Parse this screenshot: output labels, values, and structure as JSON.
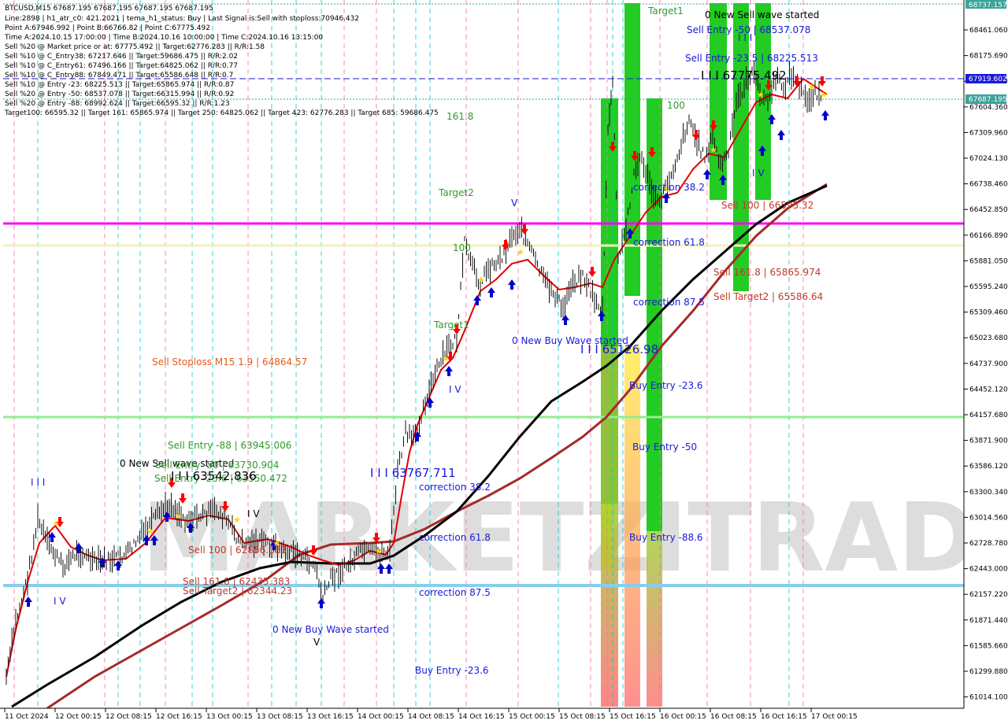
{
  "symbol_line": "BTCUSD,M15  67687.195 67687.195 67687.195 67687.195",
  "info_lines": [
    "Line:2898 | h1_atr_c0: 421.2021 | tema_h1_status: Buy | Last Signal is:Sell with stoploss:70946.432",
    "Point A:67946.992 | Point B:66766.82 | Point C:67775.492",
    "Time A:2024.10.15 17:00:00 | Time B:2024.10.16 10:00:00 | Time C:2024.10.16 13:15:00",
    "Sell %20 @ Market price or at: 67775.492 || Target:62776.283 || R/R:1.58",
    "Sell %10 @ C_Entry38: 67217.646 || Target:59686.475 || R/R:2.02",
    "Sell %10 @ C_Entry61: 67496.166 || Target:64825.062 || R/R:0.77",
    "Sell %10 @ C_Entry88: 67849.471 || Target:65586.648 || R/R:0.7",
    "Sell %10 @ Entry -23: 68225.513 || Target:65865.974 || R/R:0.87",
    "Sell %20 @ Entry -50: 68537.078 || Target:66315.994 || R/R:0.92",
    "Sell %20 @ Entry -88: 68992.624 || Target:66595.32 || R/R:1.23",
    "Target100: 66595.32 || Target 161: 65865.974 || Target 250: 64825.062 || Target 423: 62776.283 || Target 685: 59686.475"
  ],
  "price_axis": [
    "68461.060",
    "68175.690",
    "67890.320",
    "67604.360",
    "67309.960",
    "67024.130",
    "66738.460",
    "66452.850",
    "66166.890",
    "65881.050",
    "65595.240",
    "65309.460",
    "65023.680",
    "64737.900",
    "64452.120",
    "64157.680",
    "63871.900",
    "63586.120",
    "63300.340",
    "63014.560",
    "62728.780",
    "62443.000",
    "62157.220",
    "61871.440",
    "61585.660",
    "61299.880",
    "61014.100"
  ],
  "price_badges": {
    "top": "68737.157",
    "blue": "67919.602",
    "green": "67687.195"
  },
  "time_axis": [
    "11 Oct 2024",
    "12 Oct 00:15",
    "12 Oct 08:15",
    "12 Oct 16:15",
    "13 Oct 00:15",
    "13 Oct 08:15",
    "13 Oct 16:15",
    "14 Oct 00:15",
    "14 Oct 08:15",
    "14 Oct 16:15",
    "15 Oct 00:15",
    "15 Oct 08:15",
    "15 Oct 16:15",
    "16 Oct 00:15",
    "16 Oct 08:15",
    "16 Oct 16:15",
    "17 Oct 00:15"
  ],
  "labels": {
    "target1_top": "Target1",
    "new_sell_top": "0 New Sell wave started",
    "sell_entry_50_top": "Sell Entry -50 | 68537.078",
    "sell_entry_23_top": "Sell Entry -23.5 | 68225.513",
    "pointc": "I I I 67775.492",
    "l161": "161.8",
    "l100a": "100",
    "target2": "Target2",
    "l100b": "100",
    "target1_mid": "Target1",
    "corr38_top": "correction 38.2",
    "corr61_top": "correction 61.8",
    "corr87_top": "correction 87.5",
    "sell100_r": "Sell 100 | 66595.32",
    "sell161_r": "Sell 161.8 | 65865.974",
    "selltarget2_r": "Sell Target2 | 65586.64",
    "newbuy_mid": "0 New Buy Wave started",
    "pointb": "I I I 65126.98",
    "stoploss": "Sell Stoploss M15 1.9 | 64864.57",
    "buy23_r": "Buy Entry -23.6",
    "buy50_r": "Buy Entry -50",
    "buy88_r": "Buy Entry -88.6",
    "sell88_l": "Sell Entry -88 | 63945.006",
    "newsell_l": "0 New Sell wave started",
    "sell50_l": "Sell Entry -50 | 63730.904",
    "sell23_l": "Sell Entry -23.6 | 63550.472",
    "pointc_l": "I I I 63542.836",
    "pointa_l": "I I I 63767.711",
    "corr38_l": "correction 38.2",
    "corr61_l": "correction 61.8",
    "corr87_l": "correction 87.5",
    "sell100_l": "Sell 100 | 62856.163",
    "sell161_l": "Sell 161.8 | 62435.383",
    "selltarget2_l": "Sell Target2 | 62344.23",
    "newbuy_l": "0 New Buy Wave started",
    "buy23_l": "Buy Entry -23.6",
    "iii_l": "I I I",
    "iv_l": "I V",
    "iv2_l": "I V",
    "v_l": "V",
    "v_mid": "V",
    "iv_mid": "I V",
    "iv_r": "I V",
    "iii_r": "I I I"
  },
  "watermark": "MARKETZITRADE",
  "colors": {
    "magenta_line": "#ff00ff",
    "green_line": "#7cfc7c",
    "cream_line": "#f5f5c8",
    "skyblue_line": "#87ceeb",
    "red_ma": "#e00000",
    "brown_ma": "#a52a2a",
    "black_ma": "#000000",
    "bright_green": "#22cc22",
    "buy_arrow": "#0000cc",
    "sell_arrow": "#ff0000"
  }
}
